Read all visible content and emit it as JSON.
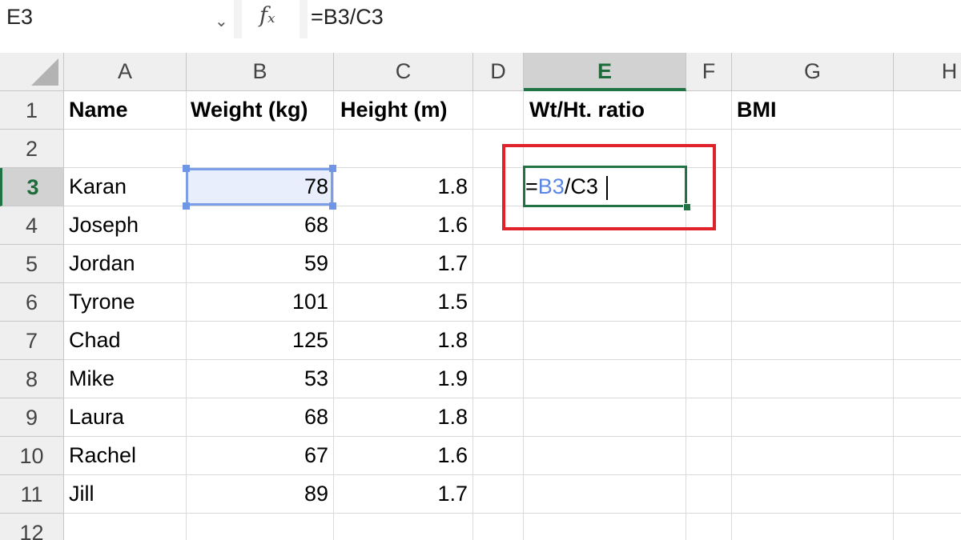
{
  "formula_bar": {
    "name_box": "E3",
    "name_box_dropdown_icon": "chevron-down-icon",
    "fx_icon": "fx-icon",
    "fx_label": "fx",
    "formula": "=B3/C3"
  },
  "columns": [
    "A",
    "B",
    "C",
    "D",
    "E",
    "F",
    "G",
    "H"
  ],
  "active_column": "E",
  "rows": [
    "1",
    "2",
    "3",
    "4",
    "5",
    "6",
    "7",
    "8",
    "9",
    "10",
    "11",
    "12"
  ],
  "active_row": "3",
  "headers": {
    "name": "Name",
    "weight": "Weight (kg)",
    "height": "Height (m)",
    "ratio": "Wt/Ht. ratio",
    "bmi": "BMI"
  },
  "data_rows": [
    {
      "name": "Karan",
      "weight": "78",
      "height": "1.8"
    },
    {
      "name": "Joseph",
      "weight": "68",
      "height": "1.6"
    },
    {
      "name": "Jordan",
      "weight": "59",
      "height": "1.7"
    },
    {
      "name": "Tyrone",
      "weight": "101",
      "height": "1.5"
    },
    {
      "name": "Chad",
      "weight": "125",
      "height": "1.8"
    },
    {
      "name": "Mike",
      "weight": "53",
      "height": "1.9"
    },
    {
      "name": "Laura",
      "weight": "68",
      "height": "1.8"
    },
    {
      "name": "Rachel",
      "weight": "67",
      "height": "1.6"
    },
    {
      "name": "Jill",
      "weight": "89",
      "height": "1.7"
    }
  ],
  "editing_cell": {
    "prefix": "=",
    "ref_b": "B3",
    "rest": "/C3"
  },
  "colors": {
    "accent_green": "#217346",
    "ref_blue": "#5b86e5",
    "annotation_red": "#e0232a"
  }
}
